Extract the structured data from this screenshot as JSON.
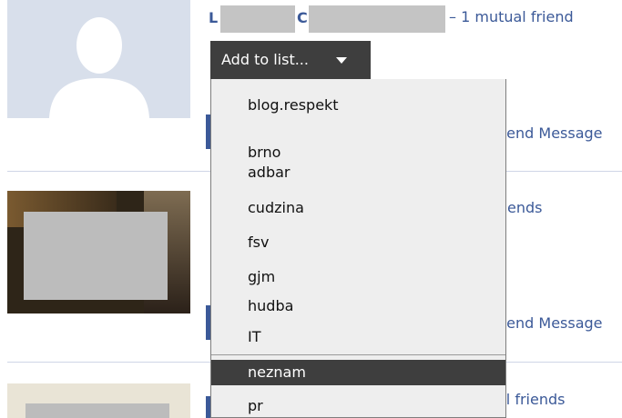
{
  "friend": {
    "name_first_initial": "L",
    "name_last_initial": "C",
    "mutual_friends": "– 1 mutual friend",
    "add_to_list_label": "Add to list..."
  },
  "side_links": {
    "send_message_1": "Send Message",
    "friends_2": "riends",
    "send_message_2": "Send Message",
    "friends_3": "al friends"
  },
  "menu": {
    "items": [
      {
        "label": "blog.respekt"
      },
      {
        "label": "brno"
      },
      {
        "label": "adbar"
      },
      {
        "label": "cudzina"
      },
      {
        "label": "fsv"
      },
      {
        "label": "gjm"
      },
      {
        "label": "hudba"
      },
      {
        "label": "IT"
      },
      {
        "label": "neznam"
      },
      {
        "label": "pr"
      }
    ],
    "selected_label": "neznam"
  },
  "colors": {
    "link": "#3b5998",
    "button_bg": "#3e3e3e",
    "menu_bg": "#eeeeee"
  }
}
